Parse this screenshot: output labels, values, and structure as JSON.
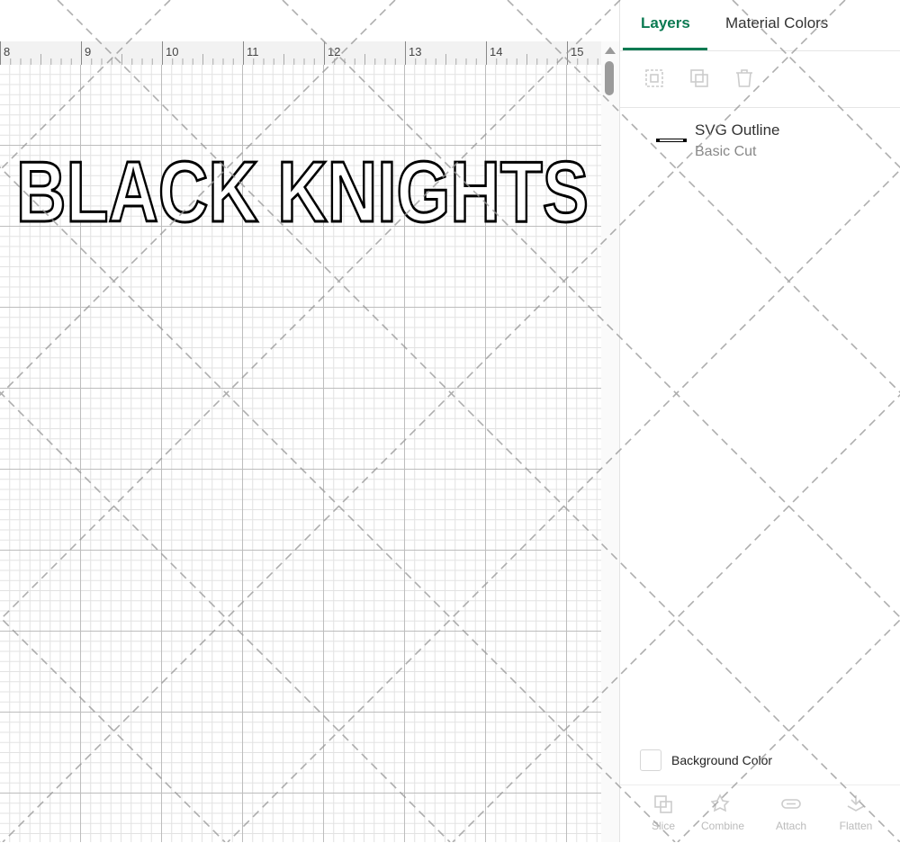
{
  "ruler": {
    "ticks": [
      "8",
      "9",
      "10",
      "11",
      "12",
      "13",
      "14",
      "15"
    ]
  },
  "design": {
    "text": "BLACK KNIGHTS"
  },
  "panel": {
    "tabs": [
      {
        "label": "Layers",
        "active": true
      },
      {
        "label": "Material Colors",
        "active": false
      }
    ],
    "toolbar": {
      "icons": [
        "group-icon",
        "duplicate-icon",
        "delete-icon"
      ]
    },
    "layers": [
      {
        "name": "SVG Outline",
        "operation": "Basic Cut"
      }
    ],
    "background": {
      "label": "Background Color"
    },
    "bottom": {
      "slice": "Slice",
      "combine": "Combine",
      "attach": "Attach",
      "flatten": "Flatten"
    }
  },
  "colors": {
    "accent": "#0b7a52",
    "grid_major": "#bdbdbd",
    "grid_minor": "#e2e2e2"
  }
}
